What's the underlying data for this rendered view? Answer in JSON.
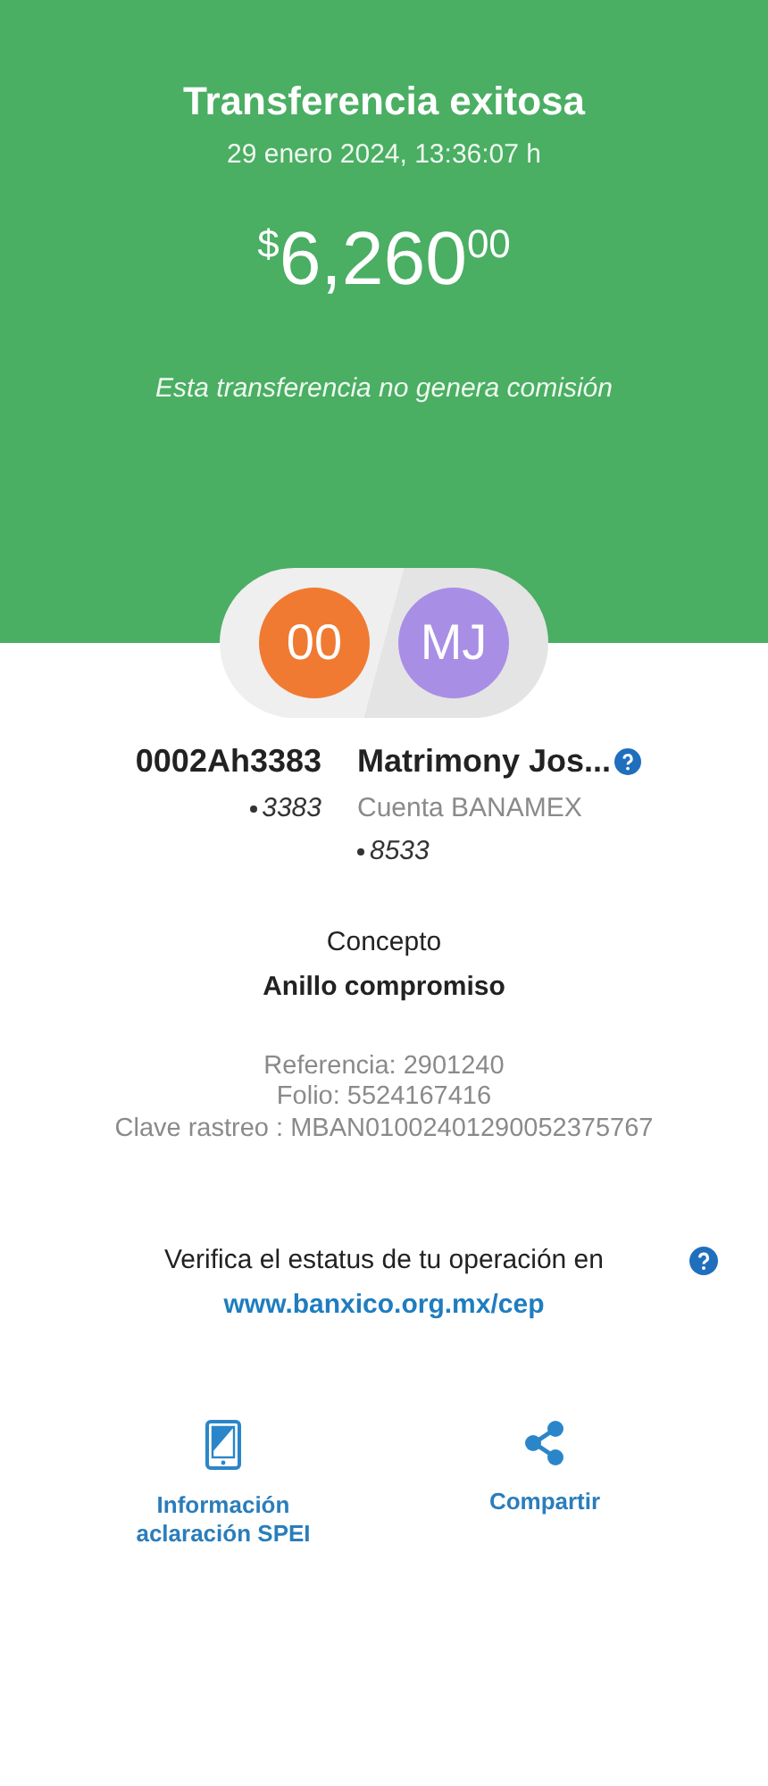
{
  "header": {
    "title": "Transferencia exitosa",
    "datetime": "29 enero 2024, 13:36:07 h",
    "amount": {
      "currency": "$",
      "whole": "6,260",
      "cents": "00"
    },
    "note": "Esta transferencia no genera comisión"
  },
  "parties": [
    {
      "initials": "00",
      "color": "#f07a32",
      "name": "0002Ah3383",
      "account": "3383",
      "help": false
    },
    {
      "initials": "MJ",
      "color": "#a98ee6",
      "name": "Matrimony Jos...",
      "bank": "Cuenta BANAMEX",
      "account": "8533",
      "help": true
    }
  ],
  "concept": {
    "label": "Concepto",
    "value": "Anillo compromiso"
  },
  "details": [
    "Referencia: 2901240",
    "Folio: 5524167416",
    "Clave rastreo : MBAN01002401290052375767"
  ],
  "verify": {
    "text": "Verifica el estatus de tu operación en",
    "link": "www.banxico.org.mx/cep"
  },
  "actions": [
    {
      "kind": "phone",
      "label": "Información aclaración SPEI"
    },
    {
      "kind": "share",
      "label": "Compartir"
    }
  ]
}
